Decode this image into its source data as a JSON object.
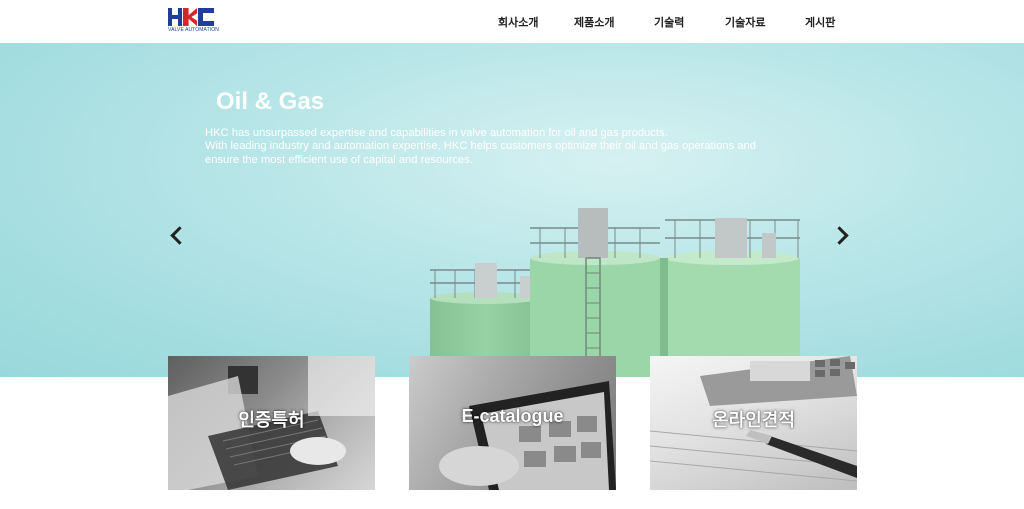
{
  "logo": {
    "subtext": "VALVE AUTOMATION"
  },
  "nav": {
    "items": [
      {
        "label": "회사소개"
      },
      {
        "label": "제품소개"
      },
      {
        "label": "기술력"
      },
      {
        "label": "기술자료"
      },
      {
        "label": "게시판"
      }
    ]
  },
  "hero": {
    "title": "Oil & Gas",
    "lines": [
      "HKC has unsurpassed expertise and capabilities in valve automation for oil and gas products.",
      "With leading industry and automation expertise, HKC helps customers optimize their oil and gas operations and",
      "ensure the most efficient use of capital and resources."
    ]
  },
  "tiles": [
    {
      "label": "인증특허"
    },
    {
      "label": "E-catalogue"
    },
    {
      "label": "온라인견적"
    }
  ],
  "colors": {
    "brand_blue": "#1f3d99",
    "brand_red": "#d7262b",
    "hero_bg": "#a4dde0",
    "tank_green": "#9fd6a8"
  }
}
